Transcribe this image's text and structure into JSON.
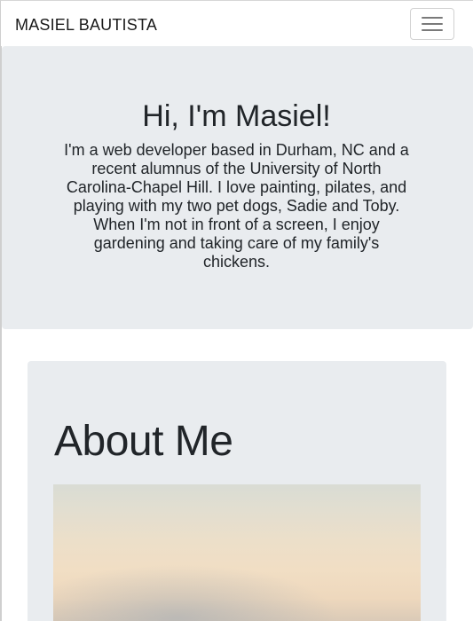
{
  "navbar": {
    "brand": "MASIEL BAUTISTA",
    "toggle_icon": "hamburger-menu-icon"
  },
  "hero": {
    "title": "Hi, I'm Masiel!",
    "text": "I'm a web developer based in Durham, NC and a recent alumnus of the University of North Carolina-Chapel Hill. I love painting, pilates, and playing with my two pet dogs, Sadie and Toby. When I'm not in front of a screen, I enjoy gardening and taking care of my family's chickens."
  },
  "about": {
    "title": "About Me"
  },
  "colors": {
    "navbar_bg": "#ffffff",
    "section_bg": "#e9ecef",
    "text": "#212529"
  }
}
